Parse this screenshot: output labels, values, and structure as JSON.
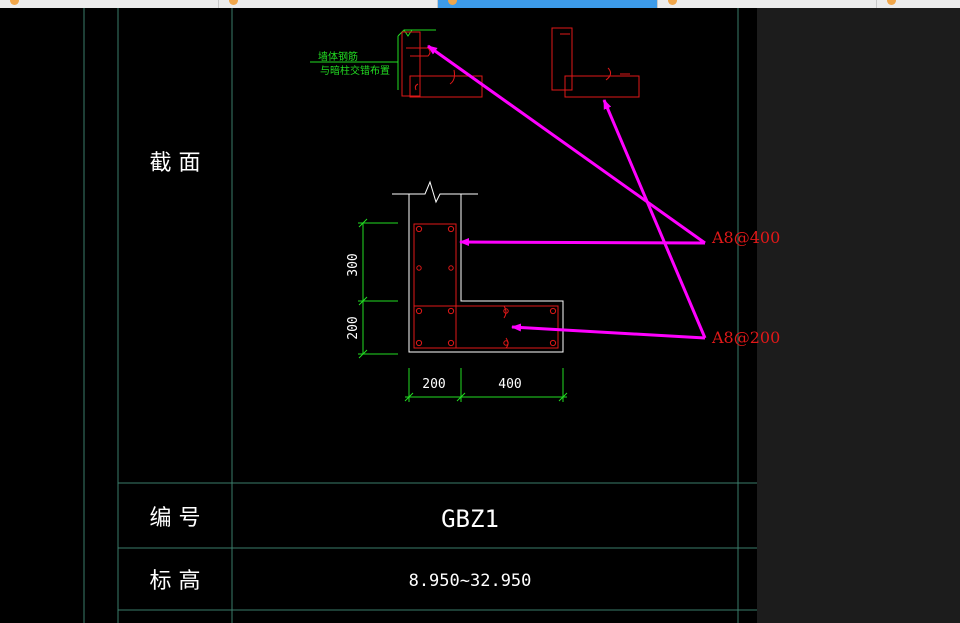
{
  "tabs": [
    "",
    "",
    "",
    "",
    ""
  ],
  "table": {
    "row_section_label": "截 面",
    "row_id_label": "编 号",
    "row_elev_label": "标 高",
    "id_value": "GBZ1",
    "elev_value": "8.950~32.950"
  },
  "detail_note": {
    "line1": "墙体钢筋",
    "line2": "与暗柱交错布置"
  },
  "dims": {
    "v_top": "300",
    "v_bottom": "200",
    "h_left": "200",
    "h_right": "400"
  },
  "annotations": {
    "a1": "A8@400",
    "a2": "A8@200"
  },
  "colors": {
    "grid": "#3a7d6a",
    "red": "#e01818",
    "green": "#22dd22",
    "white": "#ffffff",
    "magenta": "#ff00ff"
  }
}
